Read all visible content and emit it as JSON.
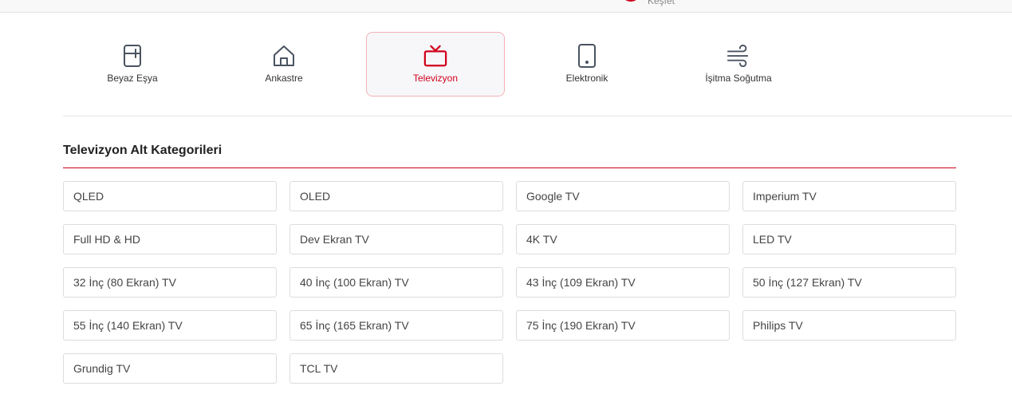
{
  "topbar": {
    "partial_text": "Keşfet"
  },
  "categories": [
    {
      "label": "Beyaz Eşya",
      "icon": "fridge-icon",
      "active": false
    },
    {
      "label": "Ankastre",
      "icon": "home-icon",
      "active": false
    },
    {
      "label": "Televizyon",
      "icon": "tv-icon",
      "active": true
    },
    {
      "label": "Elektronik",
      "icon": "phone-icon",
      "active": false
    },
    {
      "label": "İşitma Soğutma",
      "icon": "wind-icon",
      "active": false
    }
  ],
  "section": {
    "title": "Televizyon Alt Kategorileri"
  },
  "subcategories": [
    "QLED",
    "OLED",
    "Google TV",
    "Imperium TV",
    "Full HD & HD",
    "Dev Ekran TV",
    "4K TV",
    "LED TV",
    "32 İnç (80 Ekran) TV",
    "40 İnç (100 Ekran) TV",
    "43 İnç (109 Ekran) TV",
    "50 İnç (127 Ekran) TV",
    "55 İnç (140 Ekran) TV",
    "65 İnç (165 Ekran) TV",
    "75 İnç (190 Ekran) TV",
    "Philips TV",
    "Grundig TV",
    "TCL TV"
  ],
  "colors": {
    "accent": "#d0021b",
    "icon": "#4a5360"
  }
}
